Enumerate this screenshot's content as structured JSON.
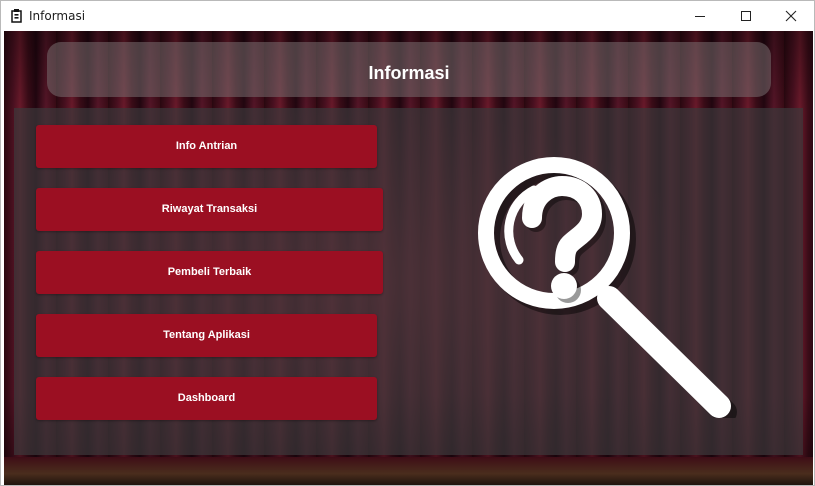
{
  "window": {
    "title": "Informasi",
    "controls": {
      "minimize": "minimize-icon",
      "maximize": "maximize-icon",
      "close": "close-icon"
    }
  },
  "header": {
    "title": "Informasi"
  },
  "menu": {
    "items": [
      {
        "label": "Info Antrian"
      },
      {
        "label": "Riwayat Transaksi"
      },
      {
        "label": "Pembeli Terbaik"
      },
      {
        "label": "Tentang Aplikasi"
      },
      {
        "label": "Dashboard"
      }
    ]
  },
  "illustration": {
    "icon": "magnifier-question-icon"
  },
  "colors": {
    "accent": "#9b0f22",
    "panel": "#3c373a"
  }
}
